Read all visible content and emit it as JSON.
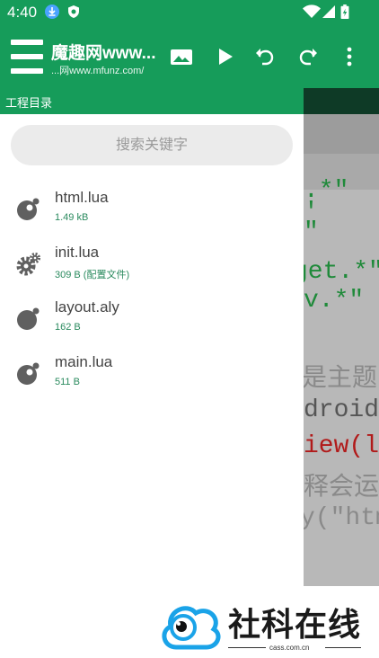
{
  "status": {
    "time": "4:40"
  },
  "app": {
    "title": "魔趣网www...",
    "subtitle": "...网www.mfunz.com/"
  },
  "strip_label": "工程目录",
  "search": {
    "placeholder": "搜索关键字"
  },
  "files": [
    {
      "name": "html.lua",
      "meta": "1.49 kB",
      "icon": "lua-file-icon"
    },
    {
      "name": "init.lua",
      "meta": "309 B  (配置文件)",
      "icon": "gear-icon"
    },
    {
      "name": "layout.aly",
      "meta": "162 B",
      "icon": "layout-file-icon"
    },
    {
      "name": "main.lua",
      "meta": "511 B",
      "icon": "lua-file-icon"
    }
  ],
  "editor_lines": [
    {
      "text": ".*\"",
      "color": "#1f8a3a"
    },
    {
      "text": "'",
      "color": "#1f8a3a"
    },
    {
      "text": "\"",
      "color": "#1f8a3a"
    },
    {
      "text": "get.*\"",
      "color": "#1f8a3a"
    },
    {
      "text": "v.*\"",
      "color": "#1f8a3a"
    },
    {
      "text": "是主题",
      "color": "#8a8a8a"
    },
    {
      "text": "droid.",
      "color": "#555555"
    },
    {
      "text": "iew(lo",
      "color": "#b11a1a"
    },
    {
      "text": "释会运",
      "color": "#8a8a8a"
    },
    {
      "text": "y(\"htm",
      "color": "#8a8a8a"
    }
  ],
  "logo": {
    "text": "社科在线",
    "url": "cass.com.cn"
  },
  "colors": {
    "primary": "#169c5a",
    "accent_text": "#2a8a5e",
    "logo_blue": "#1aa3e8"
  }
}
